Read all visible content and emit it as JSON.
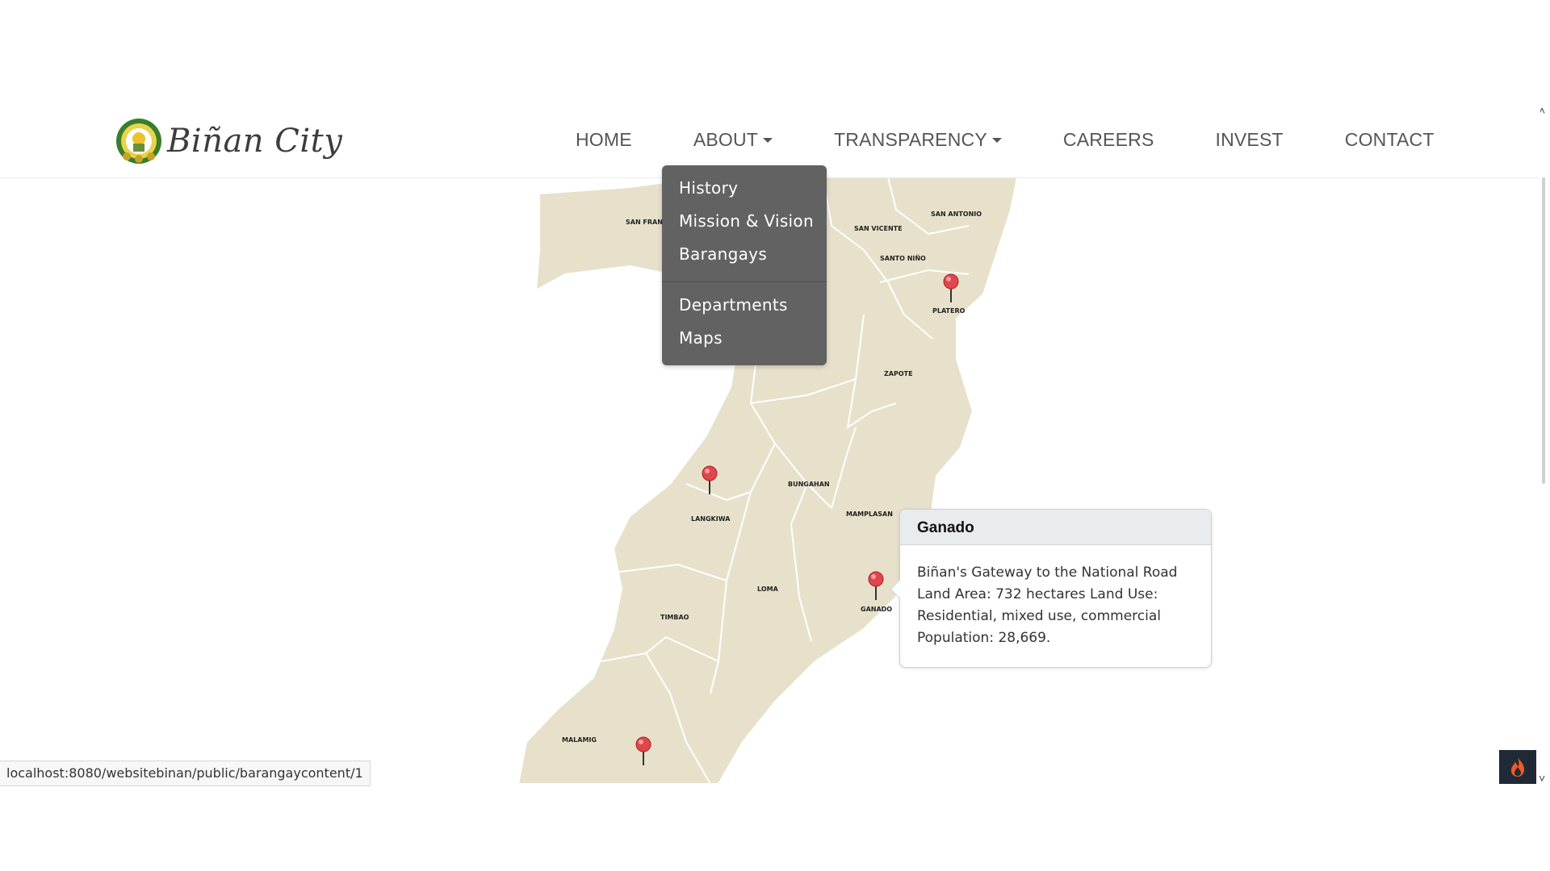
{
  "brand": {
    "name": "Biñan City",
    "logo_icon": "city-seal-icon"
  },
  "nav": {
    "items": [
      {
        "label": "HOME",
        "dropdown": false
      },
      {
        "label": "ABOUT",
        "dropdown": true
      },
      {
        "label": "TRANSPARENCY",
        "dropdown": true
      },
      {
        "label": "CAREERS",
        "dropdown": false
      },
      {
        "label": "INVEST",
        "dropdown": false
      },
      {
        "label": "CONTACT",
        "dropdown": false
      }
    ]
  },
  "about_dropdown": {
    "group1": [
      "History",
      "Mission & Vision",
      "Barangays"
    ],
    "group2": [
      "Departments",
      "Maps"
    ]
  },
  "map": {
    "barangay_labels": [
      "SAN FRANCISCO",
      "SAN VICENTE",
      "SAN ANTONIO",
      "SANTO NIÑO",
      "PLATERO",
      "ZAPOTE",
      "BUNGAHAN",
      "LANGKIWA",
      "MAMPLASAN",
      "LOMA",
      "TIMBAO",
      "GANADO",
      "MALAMIG"
    ],
    "pin_icon": "map-pin-icon"
  },
  "popover": {
    "title": "Ganado",
    "body_lines": [
      "Biñan's Gateway to the National Road",
      "Land Area: 732 hectares Land Use:",
      "Residential, mixed use, commercial",
      "Population: 28,669."
    ]
  },
  "status_bar": {
    "url": "localhost:8080/websitebinan/public/barangaycontent/1"
  },
  "floating_button": {
    "icon": "flame-icon"
  },
  "colors": {
    "map_fill": "#e7e1cb",
    "dropdown_bg": "#626262",
    "pin": "#e0464d"
  }
}
